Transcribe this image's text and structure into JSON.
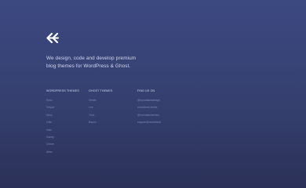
{
  "brand": {
    "logo_icon": "double-chevron-left-logo-icon",
    "tagline_line1": "We design, code and develop premium",
    "tagline_line2": "blog themes for WordPress & Ghost."
  },
  "footer": {
    "wordpress_themes": {
      "heading": "WordPress Themes",
      "items": [
        "Nuvo",
        "Vesper",
        "Nimy",
        "Odin",
        "Halo",
        "Gandy",
        "Chime",
        "Atlas"
      ]
    },
    "ghost_themes": {
      "heading": "Ghost Themes",
      "items": [
        "Vestal",
        "Lux",
        "Trios",
        "Bayon"
      ]
    },
    "find_us": {
      "heading": "Find us on",
      "items": [
        "@novoblankdesign",
        "novoblank-builds",
        "@novoblanktemes",
        "support@novoblank"
      ]
    }
  },
  "colors": {
    "background_top": "#3c4881",
    "background_bottom": "#2b3158",
    "text_light": "#d3d8ee",
    "link_muted": "#7d86b9"
  }
}
